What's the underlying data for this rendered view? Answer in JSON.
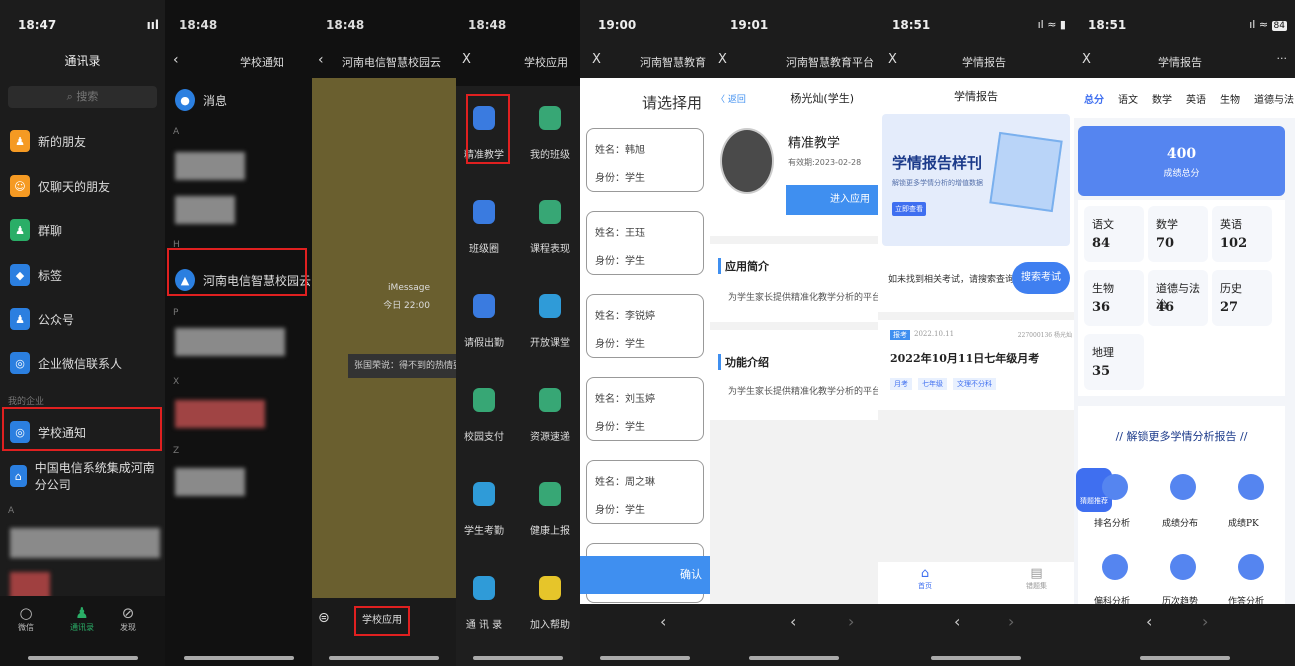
{
  "p1": {
    "time": "18:47",
    "signal": "ııl",
    "title": "通讯录",
    "search": "搜索",
    "items": [
      {
        "label": "新的朋友",
        "icon": "person-add-icon",
        "color": "#f59a23"
      },
      {
        "label": "仅聊天的朋友",
        "icon": "person-icon",
        "color": "#f59a23"
      },
      {
        "label": "群聊",
        "icon": "group-icon",
        "color": "#2aae67"
      },
      {
        "label": "标签",
        "icon": "tag-icon",
        "color": "#2b7fe0"
      },
      {
        "label": "公众号",
        "icon": "official-account-icon",
        "color": "#2b7fe0"
      },
      {
        "label": "企业微信联系人",
        "icon": "enterprise-contact-icon",
        "color": "#2b7fe0"
      }
    ],
    "section": "我的企业",
    "school_notice": "学校通知",
    "company": "中国电信系统集成河南分公司",
    "letter_a": "A",
    "tabs": [
      {
        "label": "微信",
        "icon": "chat-icon"
      },
      {
        "label": "通讯录",
        "icon": "contacts-icon"
      },
      {
        "label": "发现",
        "icon": "compass-icon"
      }
    ]
  },
  "p2": {
    "time": "18:48",
    "back": "‹",
    "title": "学校通知",
    "msg": "消息",
    "letters": [
      "A",
      "H",
      "P",
      "X",
      "Z"
    ],
    "highlight": "河南电信智慧校园云"
  },
  "p3": {
    "time": "18:48",
    "back": "‹",
    "title": "河南电信智慧校园云",
    "imessage": "iMessage",
    "imessage_time": "今日 22:00",
    "notice": "张国荣说：得不到的热情要",
    "bottom_btn": "学校应用"
  },
  "p4": {
    "time": "18:48",
    "close": "X",
    "title": "学校应用",
    "apps": [
      {
        "label": "精准教学",
        "color": "#3a7be0"
      },
      {
        "label": "我的班级",
        "color": "#37a775"
      },
      {
        "label": "班级圈",
        "color": "#3a7be0"
      },
      {
        "label": "课程表现",
        "color": "#37a775"
      },
      {
        "label": "请假出勤",
        "color": "#3a7be0"
      },
      {
        "label": "开放课堂",
        "color": "#2f9bd8"
      },
      {
        "label": "校园支付",
        "color": "#37a775"
      },
      {
        "label": "资源速递",
        "color": "#37a775"
      },
      {
        "label": "学生考勤",
        "color": "#2f9bd8"
      },
      {
        "label": "健康上报",
        "color": "#37a775"
      },
      {
        "label": "通 讯 录",
        "color": "#2f9bd8"
      },
      {
        "label": "加入帮助",
        "color": "#e6c52a"
      }
    ]
  },
  "p5": {
    "time": "19:00",
    "close": "X",
    "title": "河南智慧教育",
    "heading": "请选择用",
    "students": [
      {
        "name": "姓名：韩旭",
        "role": "身份：学生"
      },
      {
        "name": "姓名：王珏",
        "role": "身份：学生"
      },
      {
        "name": "姓名：李锐婷",
        "role": "身份：学生"
      },
      {
        "name": "姓名：刘玉婷",
        "role": "身份：学生"
      },
      {
        "name": "姓名：周之琳",
        "role": "身份：学生"
      }
    ],
    "confirm": "确认",
    "back": "‹"
  },
  "p6": {
    "time": "19:01",
    "close": "X",
    "title": "河南智慧教育平台",
    "back": "〈 返回",
    "user": "杨光灿(学生)",
    "app_name": "精准教学",
    "valid": "有效期:2023-02-28",
    "enter": "进入应用",
    "intro_title": "应用简介",
    "intro_text": "为学生家长提供精准化教学分析的平台",
    "feature_title": "功能介绍",
    "feature_text": "为学生家长提供精准化教学分析的平台",
    "nav_back": "‹",
    "nav_fwd": "›"
  },
  "p7": {
    "time": "18:51",
    "close": "X",
    "title": "学情报告",
    "subtitle": "学情报告",
    "banner_title": "学情报告样刊",
    "banner_sub": "解锁更多学情分析的增值数据",
    "banner_btn": "立即查看",
    "search_text": "如未找到相关考试，请搜索查询",
    "search_btn": "搜索考试",
    "tag": "报考",
    "date": "2022.10.11",
    "code": "227000136 杨光灿",
    "exam": "2022年10月11日七年级月考",
    "chips": [
      "月考",
      "七年级",
      "文理不分科"
    ],
    "tabs": [
      {
        "label": "首页",
        "icon": "home-icon"
      },
      {
        "label": "错题集",
        "icon": "notebook-icon"
      }
    ],
    "nav_back": "‹",
    "nav_fwd": "›"
  },
  "p8": {
    "time": "18:51",
    "battery": "84",
    "close": "X",
    "title": "学情报告",
    "more": "···",
    "subjects": [
      "总分",
      "语文",
      "数学",
      "英语",
      "生物",
      "道德与法"
    ],
    "total": "400",
    "total_label": "成绩总分",
    "scores": [
      {
        "s": "语文",
        "v": "84"
      },
      {
        "s": "数学",
        "v": "70"
      },
      {
        "s": "英语",
        "v": "102"
      },
      {
        "s": "生物",
        "v": "36"
      },
      {
        "s": "道德与法治",
        "v": "46"
      },
      {
        "s": "历史",
        "v": "27"
      },
      {
        "s": "地理",
        "v": "35"
      }
    ],
    "unlock": "解锁更多学情分析报告",
    "badge": "猜题推荐",
    "features": [
      {
        "label": "排名分析",
        "icon": "ranking-icon"
      },
      {
        "label": "成绩分布",
        "icon": "distribution-icon"
      },
      {
        "label": "成绩PK",
        "icon": "pk-icon"
      },
      {
        "label": "偏科分析",
        "icon": "subject-bias-icon"
      },
      {
        "label": "历次趋势",
        "icon": "trend-icon"
      },
      {
        "label": "作答分析",
        "icon": "answer-analysis-icon"
      }
    ],
    "nav_back": "‹",
    "nav_fwd": "›"
  }
}
